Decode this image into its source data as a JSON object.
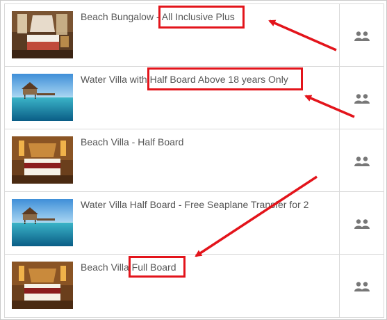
{
  "rooms": [
    {
      "name": "Beach Bungalow - All Inclusive Plus",
      "image": "bungalow-bedroom",
      "guests_icon": "two-guests-icon"
    },
    {
      "name": "Water Villa with Half Board Above 18 years Only",
      "image": "overwater-villa",
      "guests_icon": "two-guests-icon"
    },
    {
      "name": "Beach Villa - Half Board",
      "image": "villa-bedroom",
      "guests_icon": "two-guests-icon"
    },
    {
      "name": "Water Villa Half Board - Free Seaplane Transfer for 2",
      "image": "overwater-villa",
      "guests_icon": "two-guests-icon"
    },
    {
      "name": "Beach Villa Full Board",
      "image": "villa-bedroom",
      "guests_icon": "two-guests-icon"
    }
  ],
  "annotations": {
    "color": "#e3141b",
    "highlights": [
      "All Inclusive Plus",
      "Half Board Above 18 years Only",
      "Full Board"
    ]
  }
}
